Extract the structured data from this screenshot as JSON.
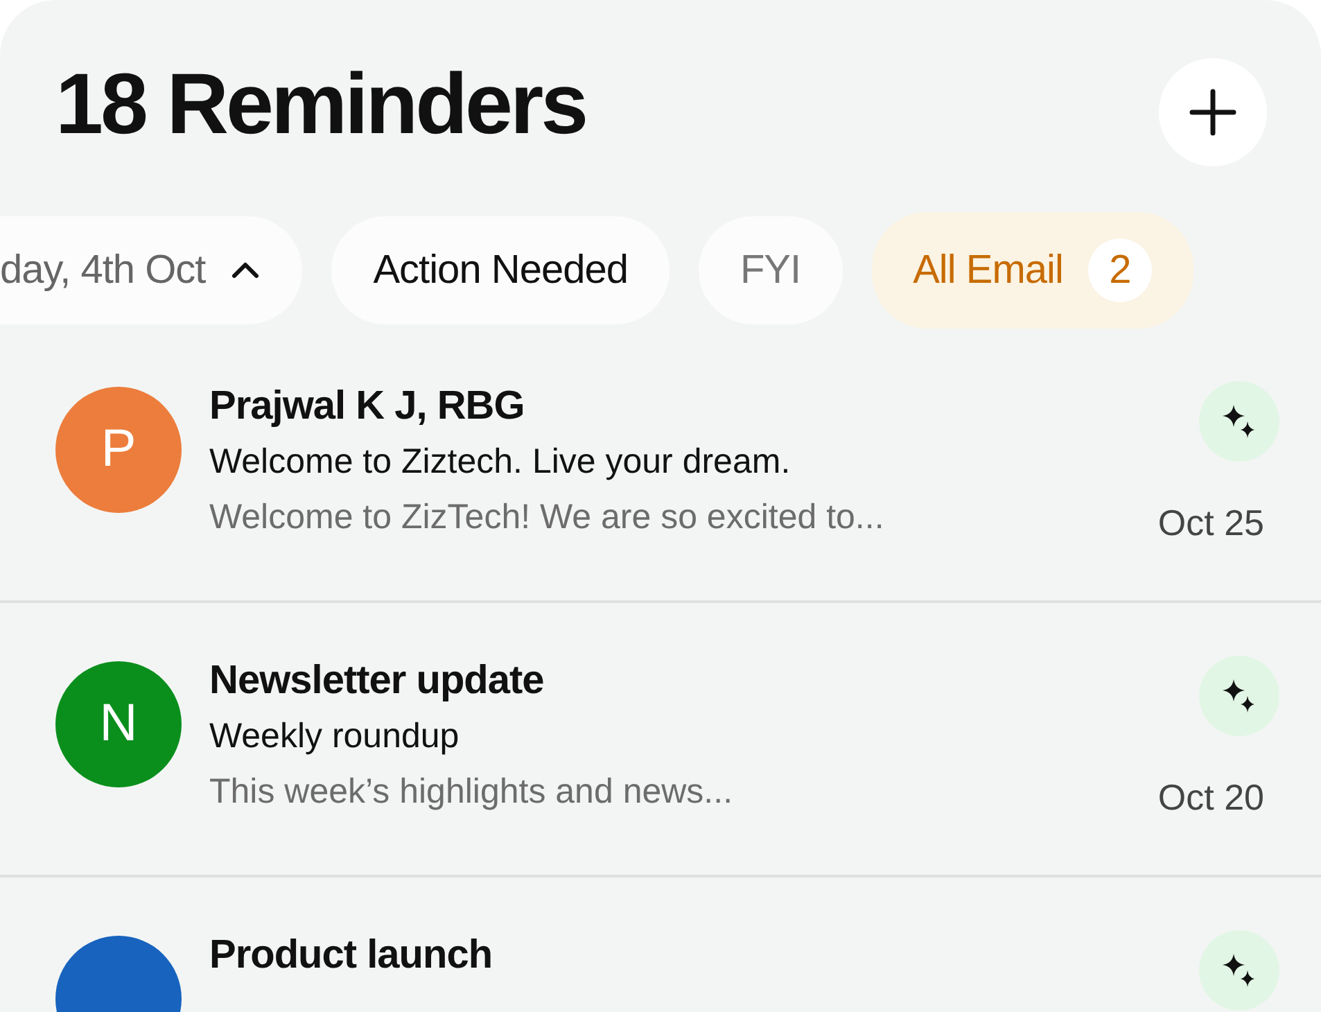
{
  "header": {
    "title": "18 Reminders"
  },
  "filters": [
    {
      "kind": "dropdown",
      "label": "day, 4th Oct",
      "selected": false
    },
    {
      "kind": "chip",
      "label": "Action Needed",
      "selected": false
    },
    {
      "kind": "chip",
      "label": "FYI",
      "selected": false
    },
    {
      "kind": "chip",
      "label": "All Email",
      "count": "2",
      "selected": true
    }
  ],
  "emails": [
    {
      "initial": "P",
      "color": "#ec7d3c",
      "sender": "Prajwal K J, RBG",
      "subject": "Welcome to Ziztech. Live your dream.",
      "preview": "Welcome to ZizTech! We are so excited to...",
      "date": "Oct 25"
    },
    {
      "initial": "N",
      "color": "#0a8f1c",
      "sender": "Newsletter update",
      "subject": "Weekly roundup",
      "preview": "This week’s highlights and news...",
      "date": "Oct 20"
    },
    {
      "color": "#1763be",
      "sender": "Product launch"
    }
  ]
}
